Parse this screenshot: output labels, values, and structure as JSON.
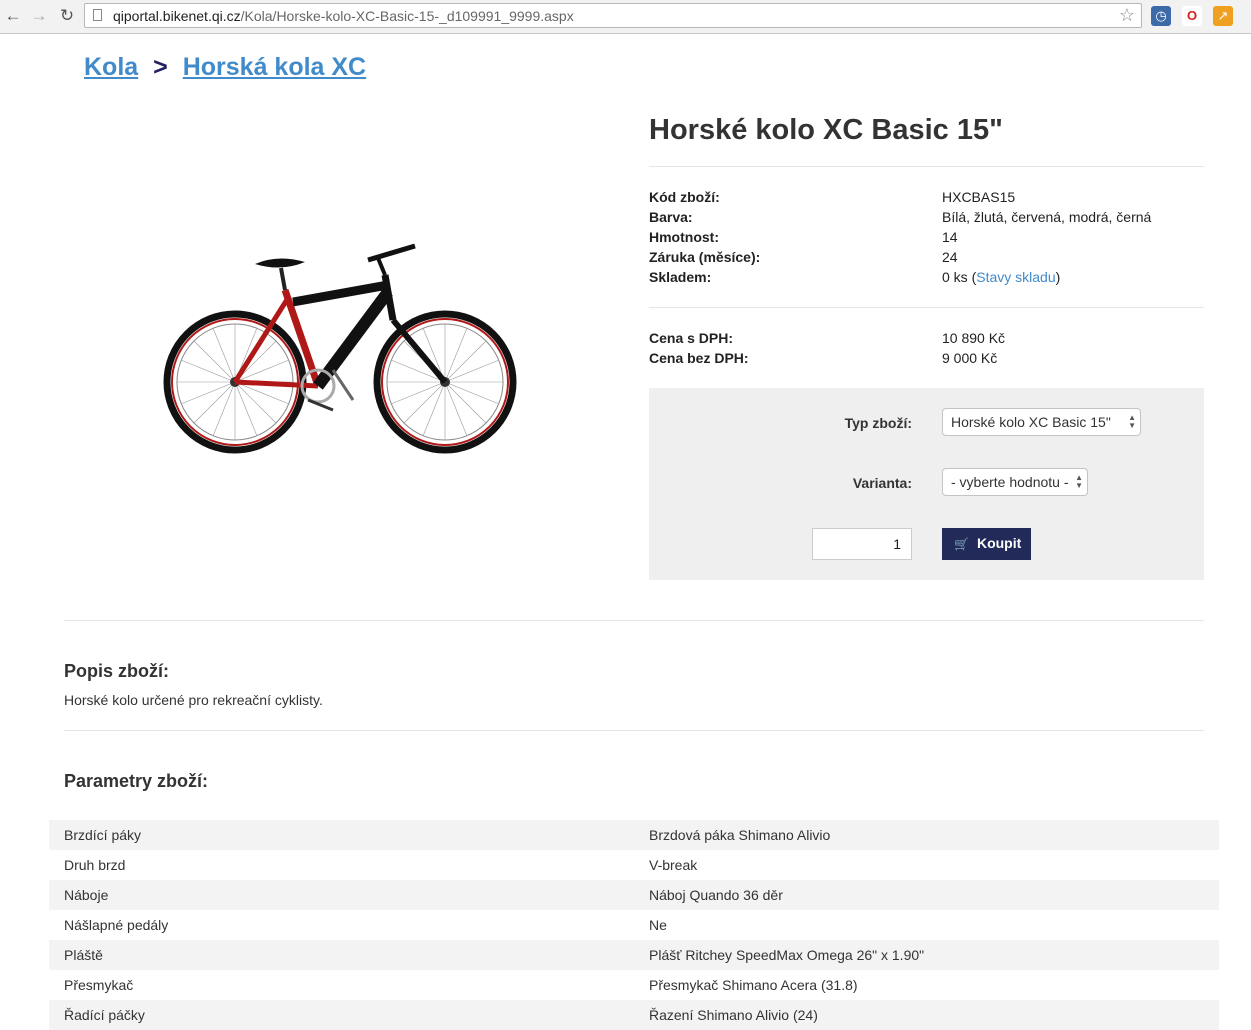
{
  "browser": {
    "url_host": "qiportal.bikenet.qi.cz",
    "url_path": "/Kola/Horske-kolo-XC-Basic-15-_d109991_9999.aspx"
  },
  "breadcrumb": {
    "items": [
      "Kola",
      "Horská kola XC"
    ],
    "separator": ">"
  },
  "product": {
    "title": "Horské kolo XC Basic 15\"",
    "properties": [
      {
        "label": "Kód zboží:",
        "value": "HXCBAS15"
      },
      {
        "label": "Barva:",
        "value": "Bílá, žlutá, červená, modrá, černá"
      },
      {
        "label": "Hmotnost:",
        "value": "14"
      },
      {
        "label": "Záruka (měsíce):",
        "value": "24"
      },
      {
        "label": "Skladem:",
        "value": "0 ks (",
        "link": "Stavy skladu",
        "suffix": ")"
      }
    ],
    "prices": [
      {
        "label": "Cena s DPH:",
        "value": "10 890 Kč"
      },
      {
        "label": "Cena bez DPH:",
        "value": "9 000 Kč"
      }
    ]
  },
  "buy": {
    "type_label": "Typ zboží:",
    "type_value": "Horské kolo XC Basic 15\"",
    "variant_label": "Varianta:",
    "variant_value": "- vyberte hodnotu -",
    "quantity": "1",
    "button_label": "Koupit"
  },
  "description": {
    "title": "Popis zboží:",
    "text": "Horské kolo určené pro rekreační cyklisty."
  },
  "parameters": {
    "title": "Parametry zboží:",
    "rows": [
      {
        "name": "Brzdící páky",
        "value": "Brzdová páka Shimano Alivio"
      },
      {
        "name": "Druh brzd",
        "value": "V-break"
      },
      {
        "name": "Náboje",
        "value": "Náboj Quando 36 děr"
      },
      {
        "name": "Nášlapné pedály",
        "value": "Ne"
      },
      {
        "name": "Pláště",
        "value": "Plášť Ritchey SpeedMax Omega 26\" x 1.90\""
      },
      {
        "name": "Přesmykač",
        "value": "Přesmykač Shimano Acera (31.8)"
      },
      {
        "name": "Řadící páčky",
        "value": "Řazení Shimano Alivio (24)"
      }
    ]
  },
  "colors": {
    "link": "#428bca",
    "buy_button": "#222a5a",
    "buy_box_bg": "#efefef",
    "bike_frame_red": "#b01818",
    "bike_frame_black": "#111111"
  }
}
